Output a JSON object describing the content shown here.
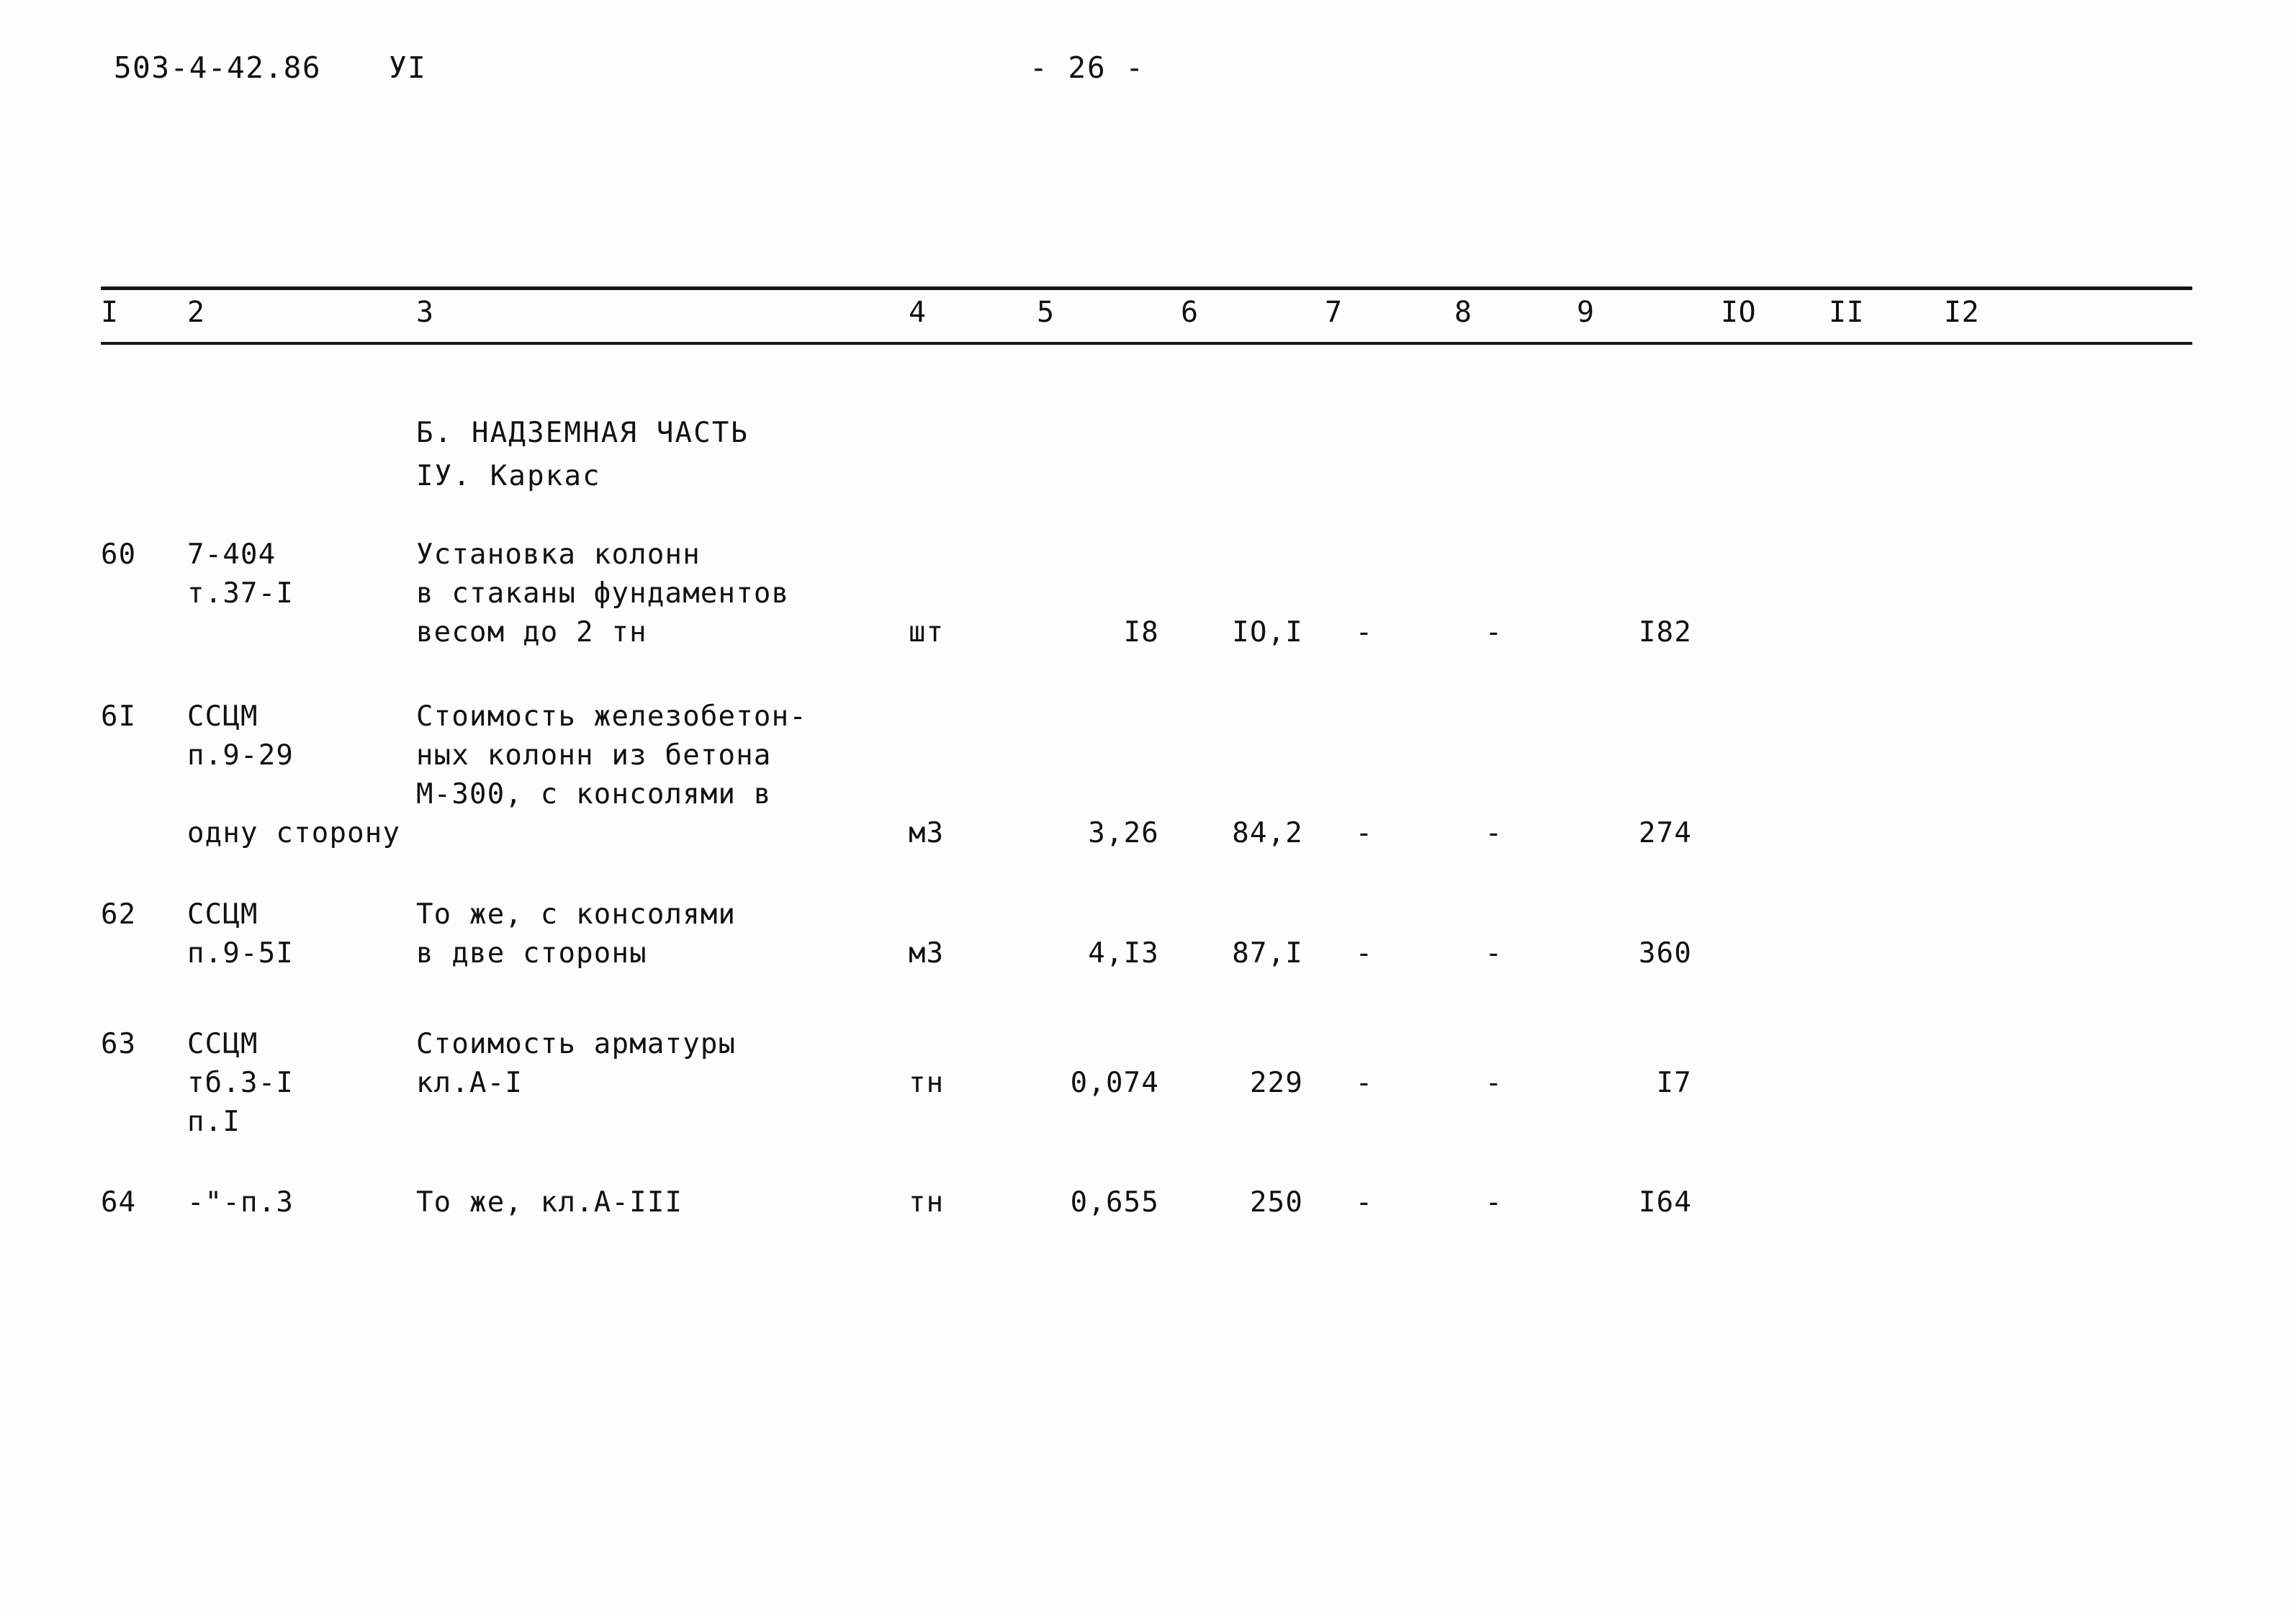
{
  "header": {
    "doc_code": "503-4-42.86",
    "volume": "УI",
    "page_number": "- 26 -"
  },
  "table": {
    "column_headers": [
      "I",
      "2",
      "3",
      "4",
      "5",
      "6",
      "7",
      "8",
      "9",
      "IO",
      "II",
      "I2"
    ],
    "sections": [
      {
        "label": "Б. НАДЗЕМНАЯ ЧАСТЬ"
      },
      {
        "label": "IУ. Каркас"
      }
    ],
    "rows": [
      {
        "num": "60",
        "code_lines": [
          "7-404",
          "т.37-I"
        ],
        "desc_lines": [
          "Установка колонн",
          "в стаканы фундаментов",
          "весом до 2 тн"
        ],
        "unit": "шт",
        "qty": "I8",
        "price": "IO,I",
        "col7": "-",
        "col8": "-",
        "col9": "I82",
        "col10": "",
        "col11": "",
        "col12": ""
      },
      {
        "num": "6I",
        "code_lines": [
          "ССЦМ",
          "п.9-29"
        ],
        "desc_lines": [
          "Стоимость железобетон-",
          "ных колонн из бетона",
          "М-300, с консолями в"
        ],
        "overflow": "одну сторону",
        "unit": "м3",
        "qty": "3,26",
        "price": "84,2",
        "col7": "-",
        "col8": "-",
        "col9": "274",
        "col10": "",
        "col11": "",
        "col12": ""
      },
      {
        "num": "62",
        "code_lines": [
          "ССЦМ",
          "п.9-5I"
        ],
        "desc_lines": [
          "То же, с консолями",
          "в две стороны"
        ],
        "unit": "м3",
        "qty": "4,I3",
        "price": "87,I",
        "col7": "-",
        "col8": "-",
        "col9": "360",
        "col10": "",
        "col11": "",
        "col12": ""
      },
      {
        "num": "63",
        "code_lines": [
          "ССЦМ",
          "тб.3-I",
          "п.I"
        ],
        "desc_lines": [
          "Стоимость арматуры",
          "кл.А-I"
        ],
        "unit": "тн",
        "qty": "0,074",
        "price": "229",
        "col7": "-",
        "col8": "-",
        "col9": "I7",
        "col10": "",
        "col11": "",
        "col12": ""
      },
      {
        "num": "64",
        "code_lines": [
          "-\"-п.3"
        ],
        "desc_lines": [
          "То же, кл.А-III"
        ],
        "unit": "тн",
        "qty": "0,655",
        "price": "250",
        "col7": "-",
        "col8": "-",
        "col9": "I64",
        "col10": "",
        "col11": "",
        "col12": ""
      }
    ]
  }
}
